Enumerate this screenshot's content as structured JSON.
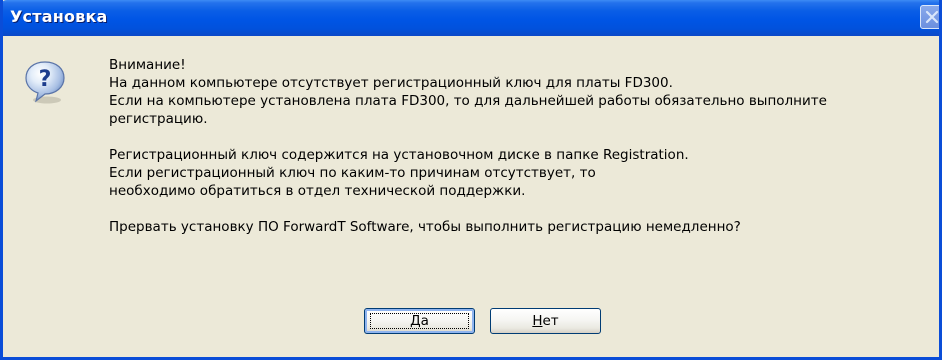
{
  "window": {
    "title": "Установка"
  },
  "icon": "question-icon",
  "message": {
    "lines_block1": [
      "Внимание!",
      "На данном компьютере отсутствует регистрационный ключ для платы FD300.",
      "Если на компьютере установлена плата FD300, то для дальнейшей работы обязательно выполните",
      "регистрацию."
    ],
    "lines_block2": [
      "Регистрационный ключ содержится на установочном диске в папке Registration.",
      "Если регистрационный ключ по каким-то причинам отсутствует, то",
      "необходимо обратиться в отдел технической поддержки."
    ],
    "question": "Прервать установку ПО ForwardT Software, чтобы выполнить регистрацию немедленно?"
  },
  "buttons": {
    "yes_label": "Да",
    "no_label": "Нет"
  },
  "colors": {
    "titlebar": "#0055e5",
    "window_bg": "#ece9d8",
    "border": "#0a4dd8"
  }
}
